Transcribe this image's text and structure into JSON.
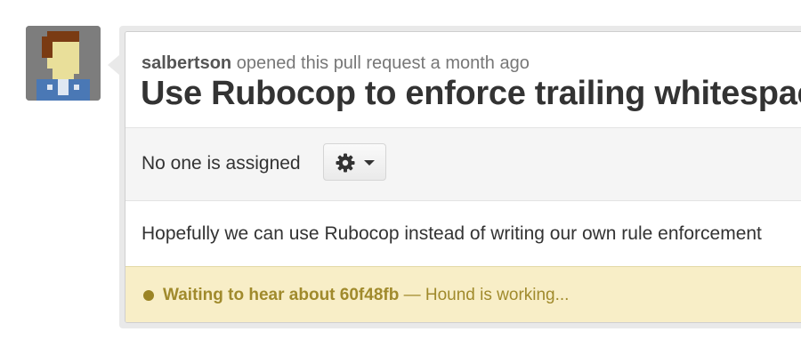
{
  "pull_request": {
    "author": "salbertson",
    "action_text": " opened this pull request a month ago",
    "title": "Use Rubocop to enforce trailing whitespace rule"
  },
  "assignee": {
    "text": "No one is assigned",
    "gear_icon": "gear-icon"
  },
  "description": {
    "text": "Hopefully we can use Rubocop instead of writing our own rule enforcement"
  },
  "status": {
    "strong_text": "Waiting to hear about 60f48fb",
    "detail_text": " — Hound is working...",
    "color": "#a08a2c",
    "background": "#f8eec7"
  }
}
